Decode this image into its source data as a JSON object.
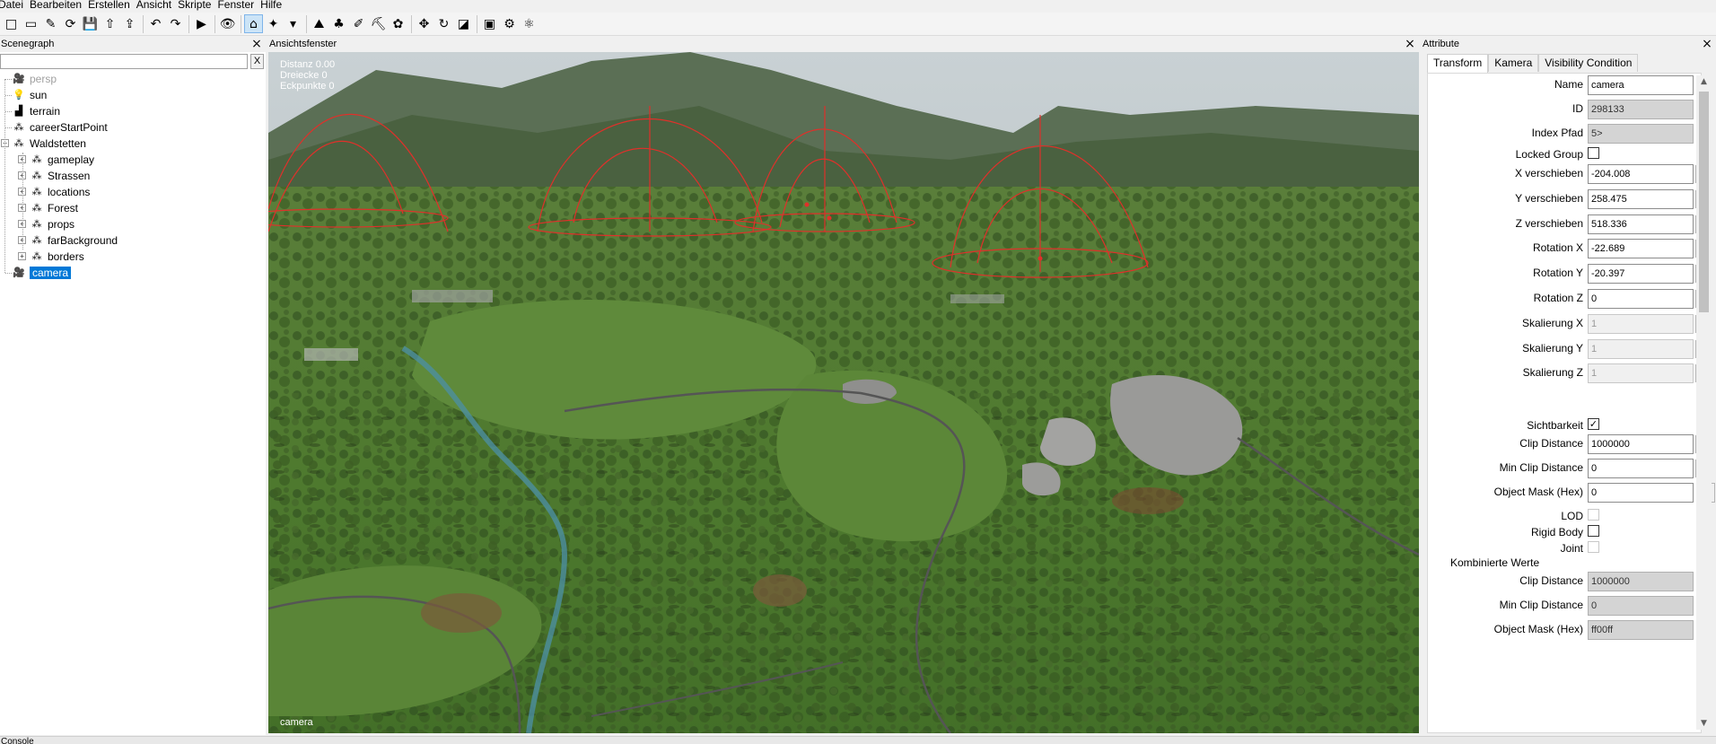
{
  "menu": [
    "Datei",
    "Bearbeiten",
    "Erstellen",
    "Ansicht",
    "Skripte",
    "Fenster",
    "Hilfe"
  ],
  "toolbar": {
    "icons": [
      "new-file-icon",
      "open-file-icon",
      "edit-file-icon",
      "reload-icon",
      "save-icon",
      "export-icon",
      "import-icon",
      "undo-icon",
      "redo-icon",
      "play-icon",
      "visibility-eye-icon",
      "select-mode-icon",
      "paint-tool-icon",
      "dropdown-arrow-icon",
      "terrain-paint-icon",
      "foliage-paint-icon",
      "decal-paint-icon",
      "terrain-sculpt-icon",
      "placement-paint-icon",
      "move-tool-icon",
      "rotate-tool-icon",
      "scale-tool-icon",
      "cube-icon",
      "gear-tool-icon",
      "settings-cog-icon"
    ],
    "glyphs": [
      "□",
      "▭",
      "✎",
      "⟳",
      "💾",
      "⇧",
      "⇪",
      "↶",
      "↷",
      "▶",
      "👁",
      "⌂",
      "✦",
      "▾",
      "⛰",
      "♣",
      "✐",
      "⛏",
      "✿",
      "✥",
      "↻",
      "◪",
      "▣",
      "⚙",
      "⚛"
    ]
  },
  "scenegraph": {
    "title": "Scenegraph",
    "close": "×",
    "search_clear": "X",
    "nodes": [
      {
        "label": "persp",
        "icon": "camera-icon",
        "glyph": "🎥",
        "dim": true
      },
      {
        "label": "sun",
        "icon": "light-bulb-icon",
        "glyph": "💡"
      },
      {
        "label": "terrain",
        "icon": "terrain-icon",
        "glyph": "▟"
      },
      {
        "label": "careerStartPoint",
        "icon": "transform-group-icon",
        "glyph": "⁂"
      },
      {
        "label": "Waldstetten",
        "icon": "transform-group-icon",
        "glyph": "⁂",
        "expand": "−"
      },
      {
        "label": "gameplay",
        "icon": "transform-group-icon",
        "glyph": "⁂",
        "expand": "+"
      },
      {
        "label": "Strassen",
        "icon": "transform-group-icon",
        "glyph": "⁂",
        "expand": "+"
      },
      {
        "label": "locations",
        "icon": "transform-group-icon",
        "glyph": "⁂",
        "expand": "+"
      },
      {
        "label": "Forest",
        "icon": "transform-group-icon",
        "glyph": "⁂",
        "expand": "+"
      },
      {
        "label": "props",
        "icon": "transform-group-icon",
        "glyph": "⁂",
        "expand": "+"
      },
      {
        "label": "farBackground",
        "icon": "transform-lock-icon",
        "glyph": "⁂",
        "expand": "+"
      },
      {
        "label": "borders",
        "icon": "transform-lock-icon",
        "glyph": "⁂",
        "expand": "+"
      },
      {
        "label": "camera",
        "icon": "camera-icon",
        "glyph": "🎥",
        "selected": true
      }
    ]
  },
  "viewport": {
    "title": "Ansichtsfenster",
    "close": "×",
    "stats": [
      "Distanz 0.00",
      "Dreiecke 0",
      "Eckpunkte 0"
    ],
    "camera_label": "camera",
    "colors": {
      "sky": "#b7c3c9",
      "grass": "#4f7a2f",
      "forest": "#2d4a1f",
      "rock": "#9a9a98",
      "gizmo": "#e0302a",
      "water": "#4c8fa0"
    }
  },
  "attributes": {
    "title": "Attribute",
    "close": "×",
    "tabs": [
      "Transform",
      "Kamera",
      "Visibility Condition"
    ],
    "name_label": "Name",
    "name_value": "camera",
    "id_label": "ID",
    "id_value": "298133",
    "index_label": "Index Pfad",
    "index_value": "5>",
    "locked_label": "Locked Group",
    "fields": [
      {
        "label": "X verschieben",
        "value": "-204.008"
      },
      {
        "label": "Y verschieben",
        "value": "258.475"
      },
      {
        "label": "Z verschieben",
        "value": "518.336"
      },
      {
        "label": "Rotation X",
        "value": "-22.689"
      },
      {
        "label": "Rotation Y",
        "value": "-20.397"
      },
      {
        "label": "Rotation Z",
        "value": "0"
      },
      {
        "label": "Skalierung X",
        "value": "1",
        "disabled": true
      },
      {
        "label": "Skalierung Y",
        "value": "1",
        "disabled": true
      },
      {
        "label": "Skalierung Z",
        "value": "1",
        "disabled": true
      }
    ],
    "visibility_label": "Sichtbarkeit",
    "visibility_check": "✓",
    "clip_label": "Clip Distance",
    "clip_value": "1000000",
    "minclip_label": "Min Clip Distance",
    "minclip_value": "0",
    "mask_label": "Object Mask (Hex)",
    "mask_value": "0",
    "mask_more": "...",
    "lod_label": "LOD",
    "rigid_label": "Rigid Body",
    "joint_label": "Joint",
    "combined_header": "Kombinierte Werte",
    "comb_clip_label": "Clip Distance",
    "comb_clip_value": "1000000",
    "comb_minclip_label": "Min Clip Distance",
    "comb_minclip_value": "0",
    "comb_mask_label": "Object Mask (Hex)",
    "comb_mask_value": "ff00ff",
    "spin_glyph": "◂▸",
    "scroll_up": "▲",
    "scroll_down": "▼"
  },
  "console": {
    "title": "Console"
  }
}
